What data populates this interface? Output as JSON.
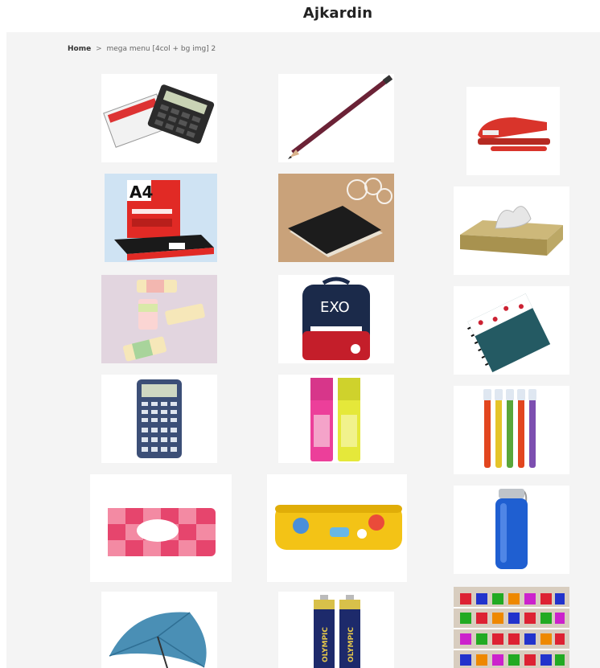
{
  "header": {
    "title": "Ajkardin"
  },
  "breadcrumb": {
    "home": "Home",
    "separator": ">",
    "current": "mega menu [4col + bg img] 2"
  },
  "products": [
    {
      "icon": "calculator-box-icon"
    },
    {
      "icon": "pencil-icon"
    },
    {
      "icon": "stapler-icon"
    },
    {
      "icon": "a4-paper-ream-icon",
      "label": "A4"
    },
    {
      "icon": "notebook-icon"
    },
    {
      "icon": "tissue-box-icon"
    },
    {
      "icon": "eraser-icon"
    },
    {
      "icon": "backpack-icon",
      "label": "EXO"
    },
    {
      "icon": "spiral-notebook-icon"
    },
    {
      "icon": "scientific-calculator-icon"
    },
    {
      "icon": "highlighter-pair-icon"
    },
    {
      "icon": "highlighter-set-icon"
    },
    {
      "icon": "pencil-pouch-icon"
    },
    {
      "icon": "pencil-box-icon"
    },
    {
      "icon": "water-bottle-icon"
    },
    {
      "icon": "umbrella-icon"
    },
    {
      "icon": "battery-icon",
      "label": "OLYMPIC"
    },
    {
      "icon": "alphabet-chart-icon"
    }
  ]
}
